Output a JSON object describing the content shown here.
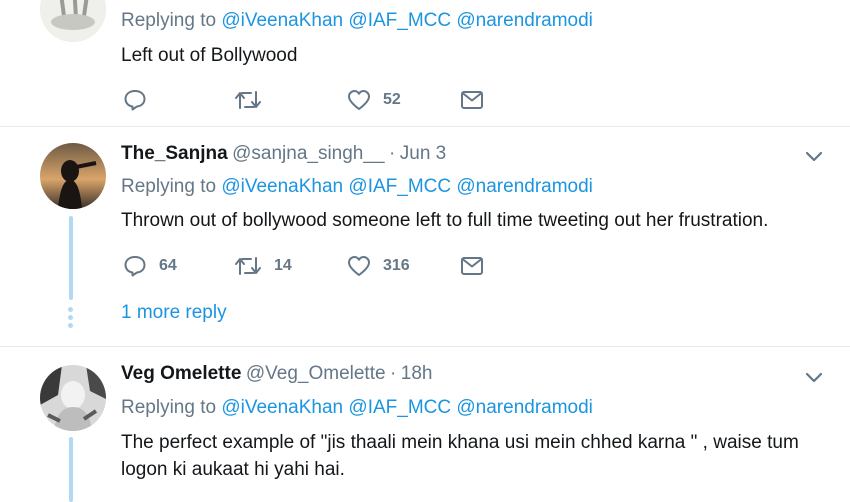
{
  "replying_prefix": "Replying to",
  "mentions": [
    "@iVeenaKhan",
    "@IAF_MCC",
    "@narendramodi"
  ],
  "tweets": [
    {
      "text": "Left out of Bollywood",
      "reply_count": "",
      "retweet_count": "",
      "like_count": "52"
    },
    {
      "name": "The_Sanjna",
      "handle": "@sanjna_singh__",
      "separator": "·",
      "time": "Jun 3",
      "text": "Thrown out of bollywood someone left to full time tweeting out her frustration.",
      "reply_count": "64",
      "retweet_count": "14",
      "like_count": "316",
      "more_replies": "1 more reply"
    },
    {
      "name": "Veg Omelette",
      "handle": "@Veg_Omelette",
      "separator": "·",
      "time": "18h",
      "text_line1": "The perfect example of \"jis thaali mein khana usi mein chhed karna \" , waise tum",
      "text_line2": "logon ki aukaat hi yahi hai."
    }
  ],
  "icons": {
    "reply": "reply-icon",
    "retweet": "retweet-icon",
    "like": "heart-icon",
    "dm": "envelope-icon",
    "caret": "chevron-down-icon"
  },
  "colors": {
    "link": "#1b95e0",
    "muted": "#657786",
    "thread": "#b1d9f5",
    "divider": "#e6ecf0"
  }
}
